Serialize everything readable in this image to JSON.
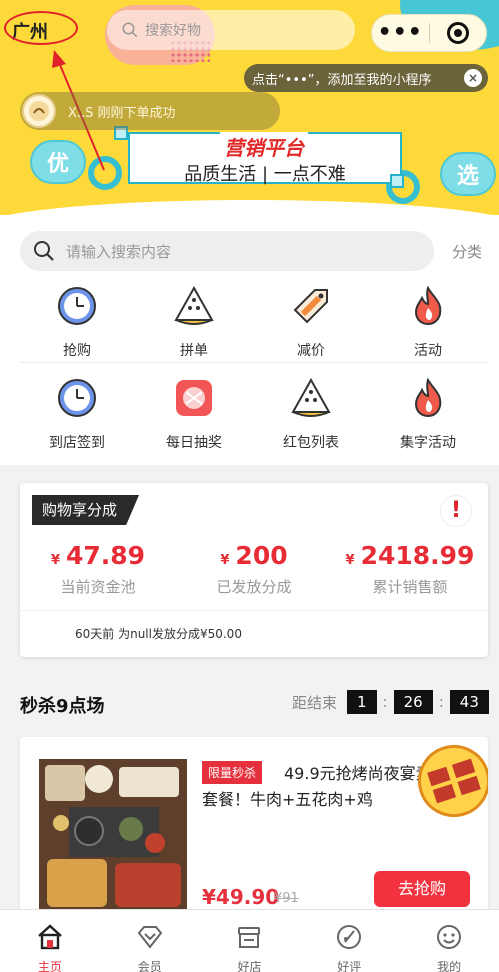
{
  "header": {
    "city": "广州",
    "search_placeholder": "搜索好物",
    "capsule_more": "•••",
    "tip": "点击“•••”，添加至我的小程序",
    "tip_close": "×",
    "order_notice": "X..S  刚刚下单成功"
  },
  "banner": {
    "title": "营销平台",
    "subtitle": "品质生活 | 一点不难",
    "left_bubble": "优",
    "right_bubble": "选"
  },
  "search": {
    "placeholder": "请输入搜索内容",
    "category_link": "分类"
  },
  "grid": [
    {
      "label": "抢购",
      "icon": "clock-icon"
    },
    {
      "label": "拼单",
      "icon": "watermelon-icon"
    },
    {
      "label": "减价",
      "icon": "price-tag-icon"
    },
    {
      "label": "活动",
      "icon": "flame-icon"
    },
    {
      "label": "到店签到",
      "icon": "clock-icon"
    },
    {
      "label": "每日抽奖",
      "icon": "lottery-icon"
    },
    {
      "label": "红包列表",
      "icon": "watermelon-icon"
    },
    {
      "label": "集字活动",
      "icon": "flame-icon"
    }
  ],
  "share": {
    "tag": "购物享分成",
    "alert": "!",
    "currency": "¥",
    "stats": [
      {
        "value": "47.89",
        "label": "当前资金池"
      },
      {
        "value": "200",
        "label": "已发放分成"
      },
      {
        "value": "2418.99",
        "label": "累计销售额"
      }
    ],
    "note": "60天前 为null发放分成¥50.00"
  },
  "flash": {
    "title": "秒杀9点场",
    "countdown_label": "距结束",
    "hours": "1",
    "minutes": "26",
    "seconds": "43"
  },
  "product": {
    "tag": "限量秒杀",
    "name": "49.9元抢烤尚夜宴素烧烤套餐！牛肉+五花肉+鸡",
    "price": "¥49.90",
    "old_price": "¥91",
    "buy_label": "去抢购"
  },
  "tabs": [
    {
      "label": "主页",
      "icon": "home-icon",
      "active": true
    },
    {
      "label": "会员",
      "icon": "diamond-icon",
      "active": false
    },
    {
      "label": "好店",
      "icon": "shop-icon",
      "active": false
    },
    {
      "label": "好评",
      "icon": "review-icon",
      "active": false
    },
    {
      "label": "我的",
      "icon": "profile-icon",
      "active": false
    }
  ],
  "colors": {
    "banner_yellow": "#fed93a",
    "accent_red": "#e5313d",
    "accent_cyan": "#26b4c8"
  }
}
